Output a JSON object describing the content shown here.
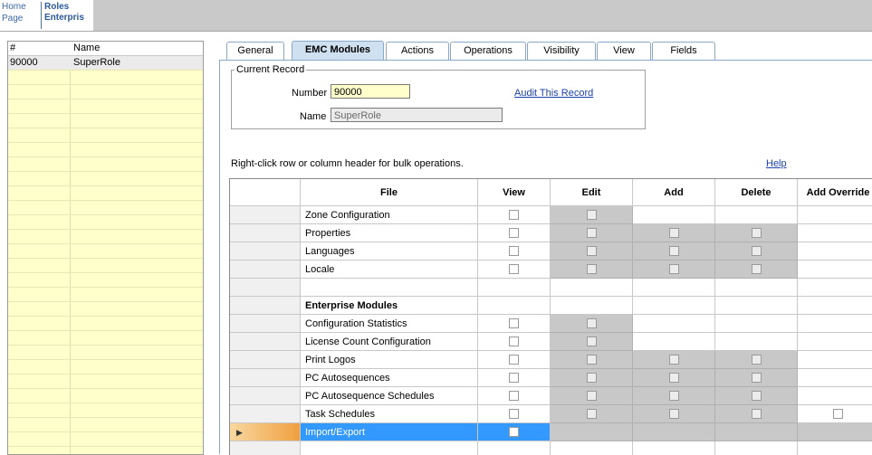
{
  "topbar": {
    "home_line1": "Home",
    "home_line2": "Page",
    "roles_line1": "Roles",
    "roles_line2": "Enterpris"
  },
  "roles_list": {
    "headers": [
      "#",
      "Name"
    ],
    "rows": [
      {
        "num": "90000",
        "name": "SuperRole"
      }
    ]
  },
  "tabs": [
    "General",
    "EMC Modules",
    "Actions",
    "Operations",
    "Visibility",
    "View",
    "Fields"
  ],
  "active_tab": "EMC Modules",
  "current_record": {
    "legend": "Current Record",
    "number_label": "Number",
    "number_value": "90000",
    "name_label": "Name",
    "name_value": "SuperRole",
    "audit_link": "Audit This Record"
  },
  "hint": "Right-click row or column header for bulk operations.",
  "help_link": "Help",
  "grid": {
    "columns": [
      "File",
      "View",
      "Edit",
      "Add",
      "Delete",
      "Add Override"
    ],
    "rows": [
      {
        "file": "Zone Configuration"
      },
      {
        "file": "Properties"
      },
      {
        "file": "Languages"
      },
      {
        "file": "Locale"
      },
      {
        "file": ""
      },
      {
        "file": "Enterprise Modules"
      },
      {
        "file": "Configuration Statistics"
      },
      {
        "file": "License Count Configuration"
      },
      {
        "file": "Print Logos"
      },
      {
        "file": "PC Autosequences"
      },
      {
        "file": "PC Autosequence Schedules"
      },
      {
        "file": "Task Schedules"
      },
      {
        "file": "Import/Export"
      },
      {
        "file": ""
      }
    ]
  }
}
